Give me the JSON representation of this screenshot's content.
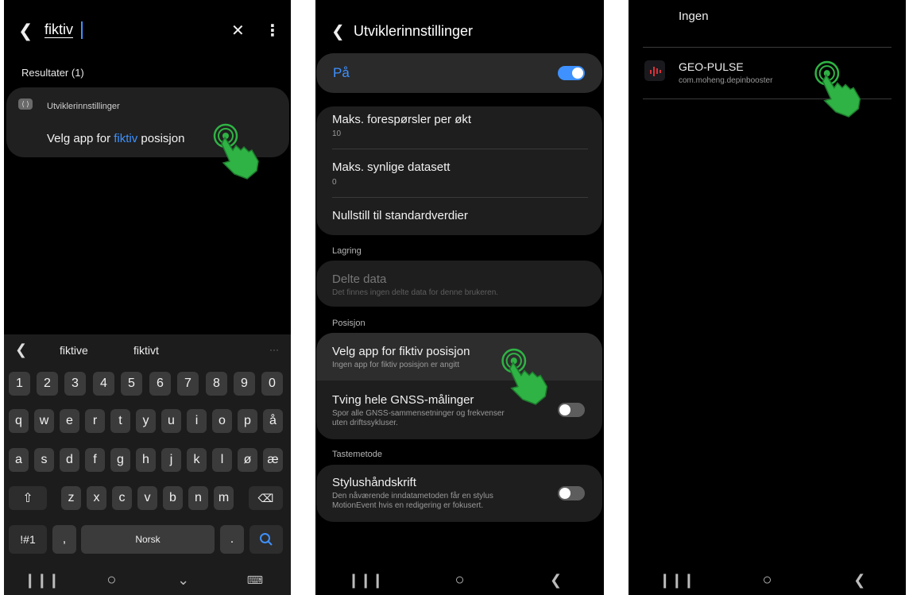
{
  "panel1": {
    "search_query": "fiktiv",
    "results_label": "Resultater (1)",
    "result": {
      "category": "Utviklerinnstillinger",
      "text_before": "Velg app for ",
      "text_highlight": "fiktiv",
      "text_after": " posisjon"
    },
    "suggestions": [
      "fiktive",
      "fiktivt"
    ],
    "more_suggestions": "···",
    "keyboard": {
      "numbers": [
        "1",
        "2",
        "3",
        "4",
        "5",
        "6",
        "7",
        "8",
        "9",
        "0"
      ],
      "row1": [
        "q",
        "w",
        "e",
        "r",
        "t",
        "y",
        "u",
        "i",
        "o",
        "p",
        "å"
      ],
      "row2": [
        "a",
        "s",
        "d",
        "f",
        "g",
        "h",
        "j",
        "k",
        "l",
        "ø",
        "æ"
      ],
      "row3": [
        "z",
        "x",
        "c",
        "v",
        "b",
        "n",
        "m"
      ],
      "symbols_key": "!#1",
      "comma_key": ",",
      "space_label": "Norsk",
      "period_key": "."
    },
    "nav_icons": [
      "recent-apps-icon",
      "home-icon",
      "hide-keyboard-icon",
      "keyboard-icon"
    ]
  },
  "panel2": {
    "header_title": "Utviklerinnstillinger",
    "master_toggle_label": "På",
    "master_toggle_on": true,
    "group1": [
      {
        "title": "Maks. forespørsler per økt",
        "value": "10"
      },
      {
        "title": "Maks. synlige datasett",
        "value": "0"
      },
      {
        "title": "Nullstill til standardverdier",
        "value": ""
      }
    ],
    "section_storage": "Lagring",
    "shared_data": {
      "title": "Delte data",
      "sub": "Det finnes ingen delte data for denne brukeren."
    },
    "section_position": "Posisjon",
    "mock_location": {
      "title": "Velg app for fiktiv posisjon",
      "sub": "Ingen app for fiktiv posisjon er angitt"
    },
    "gnss": {
      "title": "Tving hele GNSS-målinger",
      "sub_line1": "Spor alle GNSS-sammensetninger og frekvenser",
      "sub_line2": "uten driftssykluser.",
      "on": false
    },
    "section_input": "Tastemetode",
    "stylus": {
      "title": "Stylushåndskrift",
      "sub_line1": "Den nåværende inndatametoden får en stylus",
      "sub_line2": "MotionEvent hvis en redigering er fokusert.",
      "on": false
    }
  },
  "panel3": {
    "none_option": "Ingen",
    "app_name": "GEO-PULSE",
    "app_package": "com.moheng.depinbooster"
  },
  "colors": {
    "accent_blue": "#3e91ff",
    "hand_green": "#2fb344",
    "app_icon_red": "#d9303a"
  }
}
